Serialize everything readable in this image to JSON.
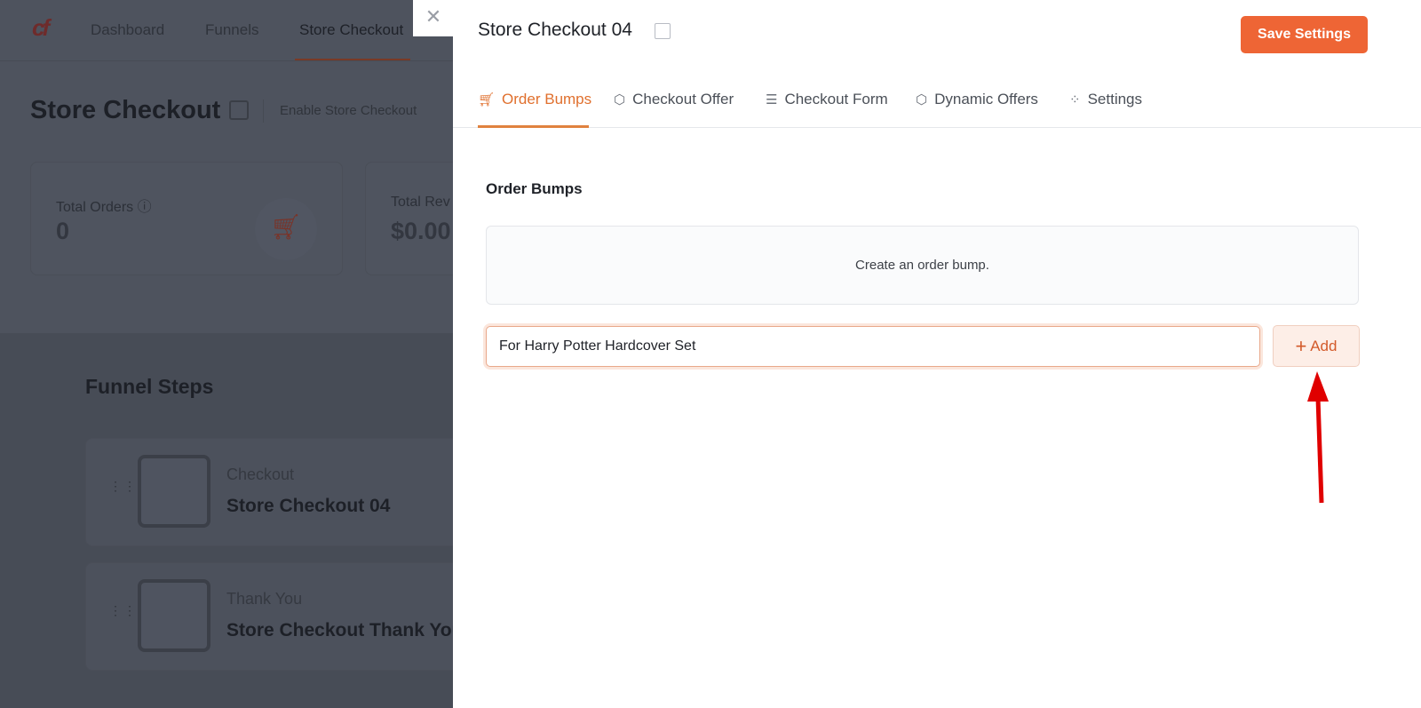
{
  "background": {
    "nav": [
      "Dashboard",
      "Funnels",
      "Store Checkout"
    ],
    "page_title": "Store Checkout",
    "enable_label": "Enable Store Checkout",
    "cards": [
      {
        "label": "Total Orders",
        "value": "0"
      },
      {
        "label": "Total Rev",
        "value": "$0.00"
      }
    ],
    "funnel_steps_title": "Funnel Steps",
    "steps": [
      {
        "type": "Checkout",
        "name": "Store Checkout 04"
      },
      {
        "type": "Thank You",
        "name": "Store Checkout Thank You"
      }
    ]
  },
  "drawer": {
    "title": "Store Checkout 04",
    "save_label": "Save Settings",
    "tabs": [
      {
        "label": "Order Bumps",
        "icon": "cart-icon"
      },
      {
        "label": "Checkout Offer",
        "icon": "box-icon"
      },
      {
        "label": "Checkout Form",
        "icon": "list-icon"
      },
      {
        "label": "Dynamic Offers",
        "icon": "box-icon"
      },
      {
        "label": "Settings",
        "icon": "grid-icon"
      }
    ],
    "section_title": "Order Bumps",
    "empty_text": "Create an order bump.",
    "input_value": "For Harry Potter Hardcover Set",
    "add_label": "Add"
  },
  "colors": {
    "accent": "#ee6535",
    "annotation_arrow": "#e00000"
  }
}
